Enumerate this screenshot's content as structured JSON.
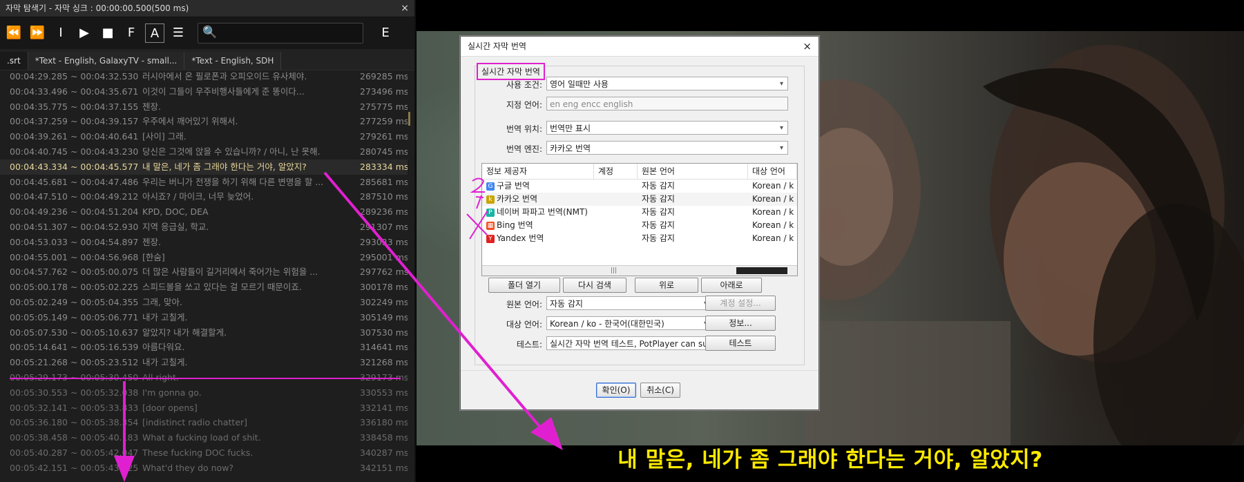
{
  "explorer": {
    "title": "자막 탐색기 - 자막 싱크 : 00:00:00.500(500 ms)",
    "close": "×",
    "toolbar": [
      "⏪",
      "⏩",
      "I",
      "▶",
      "■",
      "F",
      "A",
      "☰"
    ],
    "toolbar_icons": [
      "rewind-icon",
      "fast-forward-icon",
      "text-cursor-icon",
      "play-icon",
      "stop-icon",
      "font-f-icon",
      "font-a-icon",
      "menu-icon"
    ],
    "search_value": "",
    "e_button": "E",
    "tabs": [
      ".srt",
      "*Text - English, GalaxyTV - small...",
      "*Text - English, SDH"
    ],
    "rows": [
      {
        "time": "00:04:29.285 ~ 00:04:32.530",
        "text": "러시아에서 온 필로폰과 오피오이드 유사체야.",
        "ms": "269285 ms"
      },
      {
        "time": "00:04:33.496 ~ 00:04:35.671",
        "text": "이것이 그들이 우주비행사들에게 준 똥이다...",
        "ms": "273496 ms"
      },
      {
        "time": "00:04:35.775 ~ 00:04:37.155",
        "text": "젠장.",
        "ms": "275775 ms"
      },
      {
        "time": "00:04:37.259 ~ 00:04:39.157",
        "text": "우주에서 깨어있기 위해서.",
        "ms": "277259 ms"
      },
      {
        "time": "00:04:39.261 ~ 00:04:40.641",
        "text": "[사이] 그래.",
        "ms": "279261 ms"
      },
      {
        "time": "00:04:40.745 ~ 00:04:43.230",
        "text": "당신은 그것에 앉을 수 있습니까? / 아니, 난 못해.",
        "ms": "280745 ms"
      },
      {
        "time": "00:04:43.334 ~ 00:04:45.577",
        "text": "내 말은, 네가 좀 그래야 한다는 거야, 알았지?",
        "ms": "283334 ms"
      },
      {
        "time": "00:04:45.681 ~ 00:04:47.486",
        "text": "우리는 버니가 전쟁을 하기 위해 다른 변명을 할 ...",
        "ms": "285681 ms"
      },
      {
        "time": "00:04:47.510 ~ 00:04:49.212",
        "text": "아시죠? / 마이크, 너무 늦었어.",
        "ms": "287510 ms"
      },
      {
        "time": "00:04:49.236 ~ 00:04:51.204",
        "text": "KPD, DOC, DEA",
        "ms": "289236 ms"
      },
      {
        "time": "00:04:51.307 ~ 00:04:52.930",
        "text": "지역 응급실, 학교.",
        "ms": "291307 ms"
      },
      {
        "time": "00:04:53.033 ~ 00:04:54.897",
        "text": "젠장.",
        "ms": "293033 ms"
      },
      {
        "time": "00:04:55.001 ~ 00:04:56.968",
        "text": "[한숨]",
        "ms": "295001 ms"
      },
      {
        "time": "00:04:57.762 ~ 00:05:00.075",
        "text": "더 많은 사람들이 길거리에서 죽어가는 위험을 ...",
        "ms": "297762 ms"
      },
      {
        "time": "00:05:00.178 ~ 00:05:02.225",
        "text": "스피드볼을 쏘고 있다는 걸 모르기 때문이죠.",
        "ms": "300178 ms"
      },
      {
        "time": "00:05:02.249 ~ 00:05:04.355",
        "text": "그래, 맞아.",
        "ms": "302249 ms"
      },
      {
        "time": "00:05:05.149 ~ 00:05:06.771",
        "text": "내가 고칠게.",
        "ms": "305149 ms"
      },
      {
        "time": "00:05:07.530 ~ 00:05:10.637",
        "text": "알았지? 내가 해결할게.",
        "ms": "307530 ms"
      },
      {
        "time": "00:05:14.641 ~ 00:05:16.539",
        "text": "아름다워요.",
        "ms": "314641 ms"
      },
      {
        "time": "00:05:21.268 ~ 00:05:23.512",
        "text": "내가 고칠게.",
        "ms": "321268 ms"
      },
      {
        "time": "00:05:29.173 ~ 00:05:30.450",
        "text": "All right.",
        "ms": "329173 ms"
      },
      {
        "time": "00:05:30.553 ~ 00:05:32.038",
        "text": "I'm gonna go.",
        "ms": "330553 ms"
      },
      {
        "time": "00:05:32.141 ~ 00:05:33.833",
        "text": "[door opens]",
        "ms": "332141 ms"
      },
      {
        "time": "00:05:36.180 ~ 00:05:38.354",
        "text": "[indistinct radio chatter]",
        "ms": "336180 ms"
      },
      {
        "time": "00:05:38.458 ~ 00:05:40.183",
        "text": "What a fucking load of shit.",
        "ms": "338458 ms"
      },
      {
        "time": "00:05:40.287 ~ 00:05:42.047",
        "text": "These fucking DOC fucks.",
        "ms": "340287 ms"
      },
      {
        "time": "00:05:42.151 ~ 00:05:43.325",
        "text": "What'd they do now?",
        "ms": "342151 ms"
      }
    ]
  },
  "video": {
    "subtitle": "내 말은, 네가 좀 그래야 한다는 거야, 알았지?"
  },
  "dialog": {
    "title": "실시간 자막 번역",
    "close": "×",
    "group_label": "실시간 자막 번역",
    "fields": {
      "condition_label": "사용 조건:",
      "condition_value": "영어 일때만 사용",
      "lang_label": "지정 언어:",
      "lang_value": "en eng encc english",
      "position_label": "번역 위치:",
      "position_value": "번역만 표시",
      "engine_label": "번역 엔진:",
      "engine_value": "카카오 번역"
    },
    "list_headers": [
      "정보 제공자",
      "계정",
      "원본 언어",
      "대상 언어"
    ],
    "providers": [
      {
        "name": "구글 번역",
        "account": "",
        "source": "자동 감지",
        "target": "Korean / k",
        "icon": "google-icon",
        "icon_color": "#4285f4",
        "glyph": "G"
      },
      {
        "name": "카카오 번역",
        "account": "",
        "source": "자동 감지",
        "target": "Korean / k",
        "icon": "kakao-icon",
        "icon_color": "#c9a400",
        "glyph": "k"
      },
      {
        "name": "네이버 파파고 번역(NMT)",
        "account": "",
        "source": "자동 감지",
        "target": "Korean / k",
        "icon": "papago-icon",
        "icon_color": "#19b4a4",
        "glyph": "P"
      },
      {
        "name": "Bing 번역",
        "account": "",
        "source": "자동 감지",
        "target": "Korean / k",
        "icon": "bing-icon",
        "icon_color": "#f25022",
        "glyph": "▦"
      },
      {
        "name": "Yandex 번역",
        "account": "",
        "source": "자동 감지",
        "target": "Korean / k",
        "icon": "yandex-icon",
        "icon_color": "#e02020",
        "glyph": "Y"
      }
    ],
    "buttons": {
      "open_folder": "폴더 열기",
      "re_search": "다시 검색",
      "up": "위로",
      "down": "아래로",
      "account_settings": "계정 설정...",
      "info": "정보...",
      "test": "테스트",
      "ok": "확인(O)",
      "cancel": "취소(C)"
    },
    "source_label": "원본 언어:",
    "source_value": "자동 감지",
    "target_label": "대상 언어:",
    "target_value": "Korean / ko - 한국어(대한민국)",
    "test_label": "테스트:",
    "test_value": "실시간 자막 번역 테스트, PotPlayer can supp"
  },
  "annotations": {
    "color": "#e020d0"
  }
}
